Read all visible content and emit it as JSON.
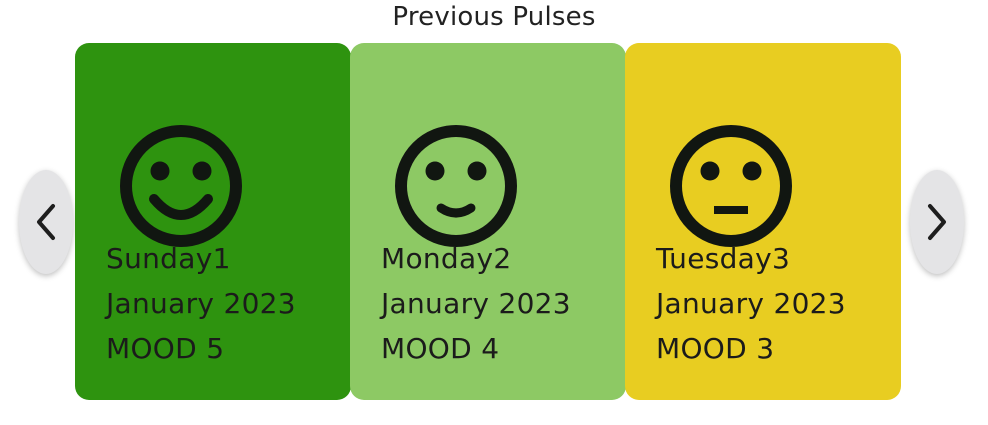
{
  "header": {
    "title": "Previous Pulses"
  },
  "navigation": {
    "prev_icon": "chevron-left-icon",
    "next_icon": "chevron-right-icon"
  },
  "cards": [
    {
      "day": "Sunday1",
      "month_year": "January 2023",
      "mood_label": "MOOD 5",
      "mood": 5,
      "icon": "big-smile-face-icon",
      "color": "#2e930f"
    },
    {
      "day": "Monday2",
      "month_year": "January 2023",
      "mood_label": "MOOD 4",
      "mood": 4,
      "icon": "small-smile-face-icon",
      "color": "#8dc964"
    },
    {
      "day": "Tuesday3",
      "month_year": "January 2023",
      "mood_label": "MOOD 3",
      "mood": 3,
      "icon": "neutral-face-icon",
      "color": "#e8cd21"
    }
  ],
  "colors": {
    "text": "#1b1b1b",
    "nav_background": "#e4e4e6"
  }
}
